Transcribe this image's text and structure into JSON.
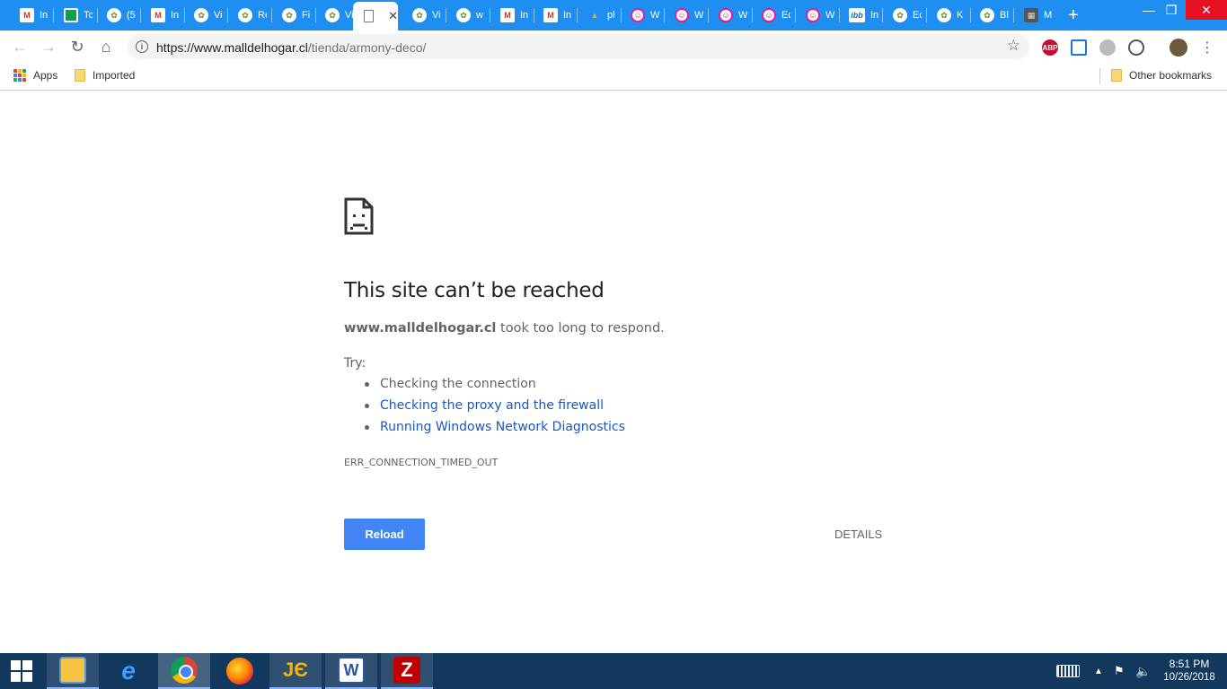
{
  "browser": {
    "tabs": [
      {
        "title": "In",
        "fav": "gmail"
      },
      {
        "title": "Tc",
        "fav": "sheets"
      },
      {
        "title": "(5",
        "fav": "generic"
      },
      {
        "title": "In",
        "fav": "gmail"
      },
      {
        "title": "Vi",
        "fav": "generic"
      },
      {
        "title": "Re",
        "fav": "generic"
      },
      {
        "title": "Fi",
        "fav": "generic"
      },
      {
        "title": "Vi",
        "fav": "generic"
      },
      {
        "title": "",
        "fav": "page",
        "active": true
      },
      {
        "title": "Vi",
        "fav": "generic"
      },
      {
        "title": "w",
        "fav": "generic"
      },
      {
        "title": "In",
        "fav": "gmail"
      },
      {
        "title": "In",
        "fav": "gmail"
      },
      {
        "title": "pl",
        "fav": "mtn"
      },
      {
        "title": "W",
        "fav": "pink"
      },
      {
        "title": "W",
        "fav": "pink"
      },
      {
        "title": "W",
        "fav": "pink"
      },
      {
        "title": "Ec",
        "fav": "pink"
      },
      {
        "title": "W",
        "fav": "pink"
      },
      {
        "title": "In",
        "fav": "ibb"
      },
      {
        "title": "Ec",
        "fav": "generic"
      },
      {
        "title": "K",
        "fav": "generic"
      },
      {
        "title": "Bl",
        "fav": "generic"
      },
      {
        "title": "M",
        "fav": "dark"
      }
    ],
    "new_tab_label": "+",
    "address": {
      "host": "https://www.malldelhogar.cl",
      "path": "/tienda/armony-deco/"
    },
    "bookmarks": {
      "apps": "Apps",
      "imported": "Imported",
      "other": "Other bookmarks"
    },
    "extensions": {
      "abp": "ABP"
    }
  },
  "error": {
    "title": "This site can’t be reached",
    "domain": "www.malldelhogar.cl",
    "message_suffix": " took too long to respond.",
    "try_label": "Try:",
    "suggestions": [
      {
        "text": "Checking the connection",
        "link": false
      },
      {
        "text": "Checking the proxy and the firewall",
        "link": true
      },
      {
        "text": "Running Windows Network Diagnostics",
        "link": true
      }
    ],
    "code": "ERR_CONNECTION_TIMED_OUT",
    "reload_label": "Reload",
    "details_label": "DETAILS"
  },
  "taskbar": {
    "apps": [
      "file-explorer",
      "internet-explorer",
      "chrome",
      "firefox",
      "jedit",
      "word",
      "filezilla"
    ],
    "running": "chrome",
    "time": "8:51 PM",
    "date": "10/26/2018"
  }
}
